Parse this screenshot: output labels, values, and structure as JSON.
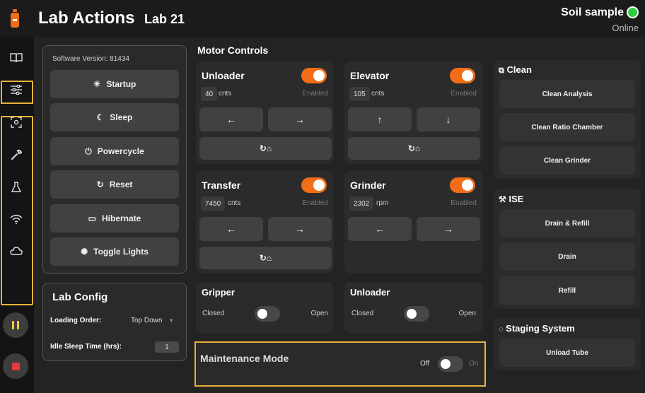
{
  "header": {
    "app_title": "Lab Actions",
    "lab_name": "Lab 21",
    "sample_name": "Soil sample",
    "status": "Online",
    "status_color": "#2ecc40",
    "accent_color": "#f26d17"
  },
  "sidebar": {
    "items": [
      {
        "icon": "book-icon"
      },
      {
        "icon": "sliders-icon"
      },
      {
        "icon": "scan-icon"
      },
      {
        "icon": "wrench-icon"
      },
      {
        "icon": "flask-icon"
      },
      {
        "icon": "wifi-icon"
      },
      {
        "icon": "cloud-icon"
      }
    ],
    "controls": [
      {
        "icon": "pause-icon"
      },
      {
        "icon": "stop-icon"
      }
    ]
  },
  "system": {
    "software_version": "Software Version: 81434",
    "buttons": [
      {
        "label": "Startup",
        "icon": "sun-icon"
      },
      {
        "label": "Sleep",
        "icon": "moon-icon"
      },
      {
        "label": "Powercycle",
        "icon": "power-icon"
      },
      {
        "label": "Reset",
        "icon": "refresh-icon"
      },
      {
        "label": "Hibernate",
        "icon": "bed-icon"
      },
      {
        "label": "Toggle Lights",
        "icon": "lightbulb-icon"
      }
    ]
  },
  "lab_config": {
    "title": "Lab Config",
    "loading_order_label": "Loading Order:",
    "loading_order_value": "Top Down",
    "idle_sleep_label": "Idle Sleep Time (hrs):",
    "idle_sleep_value": "1"
  },
  "motor_controls": {
    "title": "Motor Controls",
    "enabled_label": "Enabled",
    "motors": [
      {
        "name": "Unloader",
        "value": "40",
        "unit": "cnts",
        "enabled": true
      },
      {
        "name": "Elevator",
        "value": "105",
        "unit": "cnts",
        "enabled": true
      },
      {
        "name": "Transfer",
        "value": "7450",
        "unit": "cnts",
        "enabled": true
      },
      {
        "name": "Grinder",
        "value": "2302",
        "unit": "rpm",
        "enabled": true
      }
    ],
    "gripper": {
      "name": "Gripper",
      "off_label": "Closed",
      "on_label": "Open",
      "state": "Closed"
    },
    "unloader2": {
      "name": "Unloader",
      "off_label": "Closed",
      "on_label": "Open",
      "state": "Closed"
    }
  },
  "maintenance": {
    "title": "Maintenance Mode",
    "off_label": "Off",
    "on_label": "On",
    "state": "Off"
  },
  "clean": {
    "title": "Clean",
    "buttons": [
      "Clean Analysis",
      "Clean Ratio Chamber",
      "Clean Grinder"
    ]
  },
  "ise": {
    "title": "ISE",
    "buttons": [
      "Drain & Refill",
      "Drain",
      "Refill"
    ]
  },
  "staging": {
    "title": "Staging System",
    "buttons": [
      "Unload Tube"
    ]
  }
}
